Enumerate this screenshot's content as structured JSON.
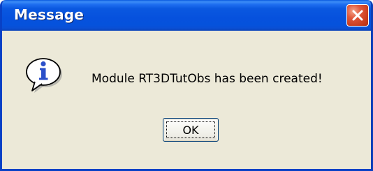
{
  "dialog": {
    "title": "Message",
    "message": "Module RT3DTutObs has been created!",
    "icon": "information-icon",
    "buttons": {
      "ok_label": "OK"
    },
    "title_bar_controls": {
      "close_icon": "close-icon"
    }
  },
  "colors": {
    "title_bar": "#0a58e0",
    "window_border": "#0841c6",
    "client_area": "#ece9d8",
    "close_button": "#e0573a",
    "info_icon_blue": "#2a4fc9"
  }
}
